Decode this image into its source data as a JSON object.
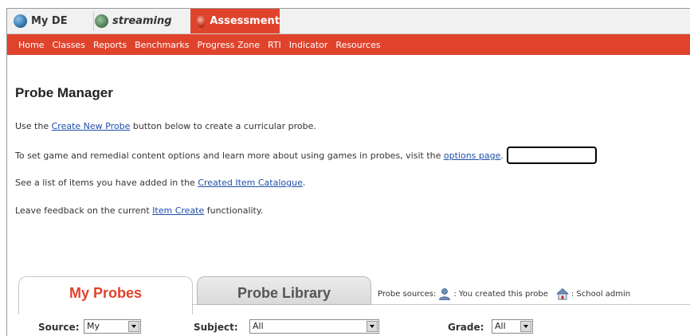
{
  "topbar": {
    "tabs": [
      {
        "label": "My DE",
        "icon": "globe-icon"
      },
      {
        "label": "streaming",
        "icon": "streaming-icon"
      },
      {
        "label": "Assessment",
        "icon": "assessment-icon"
      }
    ]
  },
  "nav": {
    "items": [
      "Home",
      "Classes",
      "Reports",
      "Benchmarks",
      "Progress Zone",
      "RTI",
      "Indicator",
      "Resources"
    ]
  },
  "page": {
    "title": "Probe Manager",
    "line1": {
      "pre": "Use the ",
      "link": "Create New Probe",
      "post": " button below to create a curricular probe."
    },
    "line2": {
      "pre": "To set game and remedial content options and learn more about using games in probes, visit the ",
      "link": "options page",
      "post": "."
    },
    "line3": {
      "pre": "See a list of items you have added in the ",
      "link": "Created Item Catalogue",
      "post": "."
    },
    "line4": {
      "pre": "Leave feedback on the current ",
      "link": "Item Create",
      "post": " functionality."
    }
  },
  "tabs": {
    "my_probes": "My Probes",
    "probe_library": "Probe Library"
  },
  "sources": {
    "label": "Probe sources:",
    "you_created": ": You created this probe",
    "school_admin": ": School admin"
  },
  "filters": {
    "source_label": "Source:",
    "source_value": "My",
    "subject_label": "Subject:",
    "subject_value": "All",
    "grade_label": "Grade:",
    "grade_value": "All"
  },
  "colors": {
    "accent": "#e0432c",
    "link": "#1f4fa8"
  }
}
